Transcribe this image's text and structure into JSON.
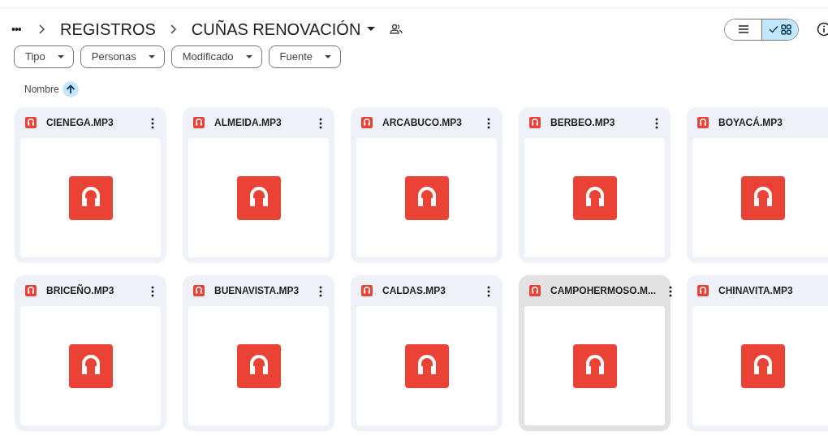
{
  "breadcrumb": {
    "more": "•••",
    "items": [
      "REGISTROS",
      "CUÑAS RENOVACIÓN"
    ]
  },
  "view_toggle": [
    {
      "kind": "list",
      "selected": false
    },
    {
      "kind": "grid",
      "selected": true
    }
  ],
  "filters": [
    "Tipo",
    "Personas",
    "Modificado",
    "Fuente"
  ],
  "sort": {
    "label": "Nombre"
  },
  "files": [
    {
      "name": "CIENEGA.MP3",
      "hovered": false,
      "menu": true
    },
    {
      "name": "ALMEIDA.MP3",
      "hovered": false,
      "menu": true
    },
    {
      "name": "ARCABUCO.MP3",
      "hovered": false,
      "menu": true
    },
    {
      "name": "BERBEO.MP3",
      "hovered": false,
      "menu": true
    },
    {
      "name": "BOYACÁ.MP3",
      "hovered": false,
      "menu": false
    },
    {
      "name": "BRICEÑO.MP3",
      "hovered": false,
      "menu": true
    },
    {
      "name": "BUENAVISTA.MP3",
      "hovered": false,
      "menu": true
    },
    {
      "name": "CALDAS.MP3",
      "hovered": false,
      "menu": true
    },
    {
      "name": "CAMPOHERMOSO.M...",
      "hovered": true,
      "menu": true
    },
    {
      "name": "CHINAVITA.MP3",
      "hovered": false,
      "menu": false
    }
  ]
}
